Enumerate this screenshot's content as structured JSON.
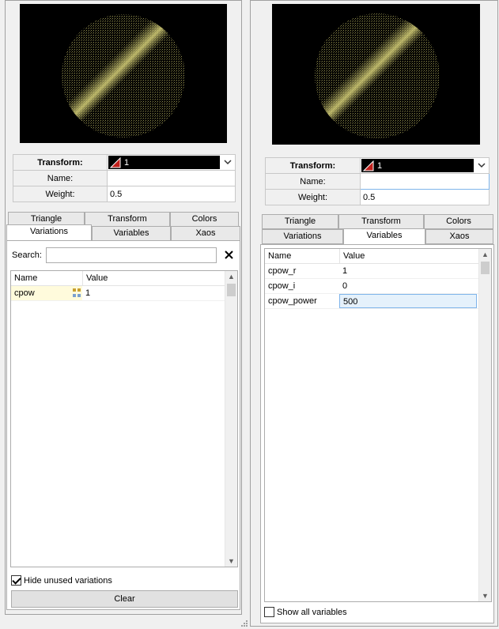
{
  "left": {
    "transform": {
      "label": "Transform:",
      "selected": "1",
      "name_label": "Name:",
      "name_value": "",
      "weight_label": "Weight:",
      "weight_value": "0.5"
    },
    "tabs_row1": [
      "Triangle",
      "Transform",
      "Colors"
    ],
    "tabs_row2": [
      "Variations",
      "Variables",
      "Xaos"
    ],
    "active_tab": "Variations",
    "search_label": "Search:",
    "columns": [
      "Name",
      "Value"
    ],
    "rows": [
      {
        "name": "cpow",
        "value": "1"
      }
    ],
    "hide_unused_label": "Hide unused variations",
    "hide_unused_checked": true,
    "clear_label": "Clear"
  },
  "right": {
    "transform": {
      "label": "Transform:",
      "selected": "1",
      "name_label": "Name:",
      "name_value": "",
      "weight_label": "Weight:",
      "weight_value": "0.5"
    },
    "tabs_row1": [
      "Triangle",
      "Transform",
      "Colors"
    ],
    "tabs_row2": [
      "Variations",
      "Variables",
      "Xaos"
    ],
    "active_tab": "Variables",
    "columns": [
      "Name",
      "Value"
    ],
    "rows": [
      {
        "name": "cpow_r",
        "value": "1"
      },
      {
        "name": "cpow_i",
        "value": "0"
      },
      {
        "name": "cpow_power",
        "value": "500"
      }
    ],
    "show_all_label": "Show all variables",
    "show_all_checked": false
  },
  "colors": {
    "fractal": "#b5b060",
    "preview_bg": "#000000",
    "triangle_icon": "#c0201c"
  },
  "icons": [
    "dropdown-arrow-icon",
    "triangle-icon",
    "close-icon",
    "variation-preview-icon",
    "scroll-up-icon",
    "scroll-down-icon",
    "resize-grip-icon"
  ]
}
